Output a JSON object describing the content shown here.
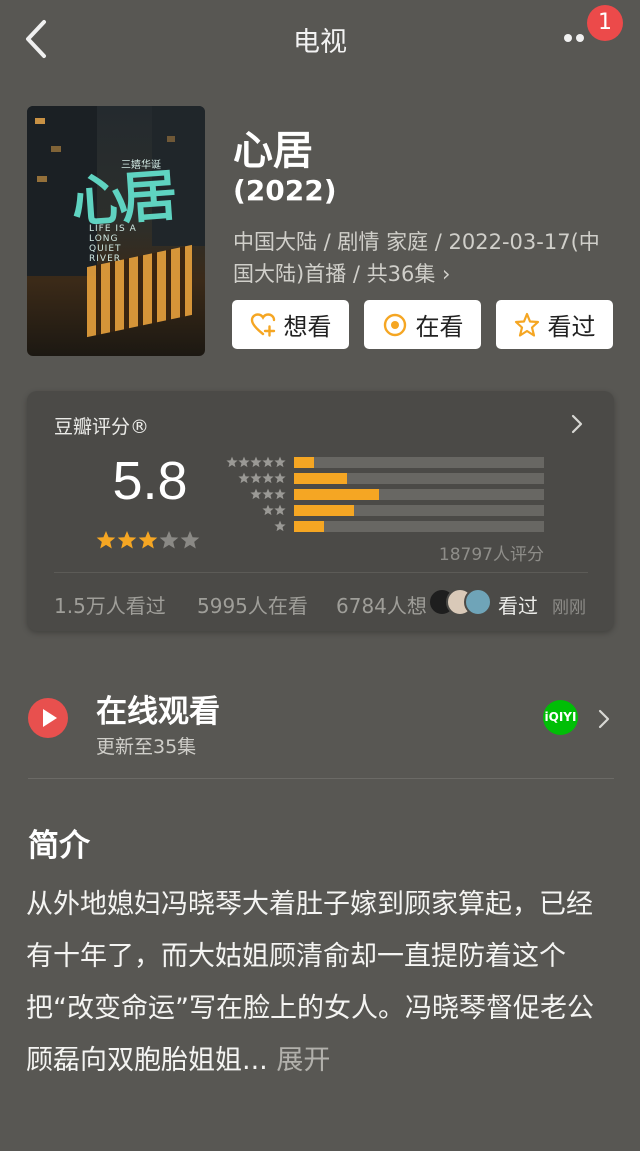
{
  "header": {
    "title": "电视",
    "notification_count": "1"
  },
  "poster": {
    "title_art": "心居",
    "subtitle_art": "LIFE IS A LONG QUIET RIVER",
    "small_art": "三嬉华诞"
  },
  "show": {
    "name": "心居",
    "year": "(2022)",
    "meta": "中国大陆 / 剧情 家庭 / 2022-03-17(中国大陆)首播 / 共36集 ›"
  },
  "actions": {
    "want": "想看",
    "watching": "在看",
    "watched": "看过"
  },
  "rating": {
    "label": "豆瓣评分®",
    "score": "5.8",
    "stars": 3,
    "count": "18797人评分",
    "distribution": [
      {
        "stars": 5,
        "fraction": 0.08
      },
      {
        "stars": 4,
        "fraction": 0.21
      },
      {
        "stars": 3,
        "fraction": 0.34
      },
      {
        "stars": 2,
        "fraction": 0.24
      },
      {
        "stars": 1,
        "fraction": 0.12
      }
    ],
    "stats": {
      "watched": "1.5万人看过",
      "watching": "5995人在看",
      "want": "6784人想",
      "friend_action": "看过",
      "time": "刚刚"
    }
  },
  "watch": {
    "title": "在线观看",
    "subtitle": "更新至35集",
    "platform_logo": "iQIYI"
  },
  "synopsis": {
    "title": "简介",
    "text": "从外地媳妇冯晓琴大着肚子嫁到顾家算起，已经有十年了，而大姑姐顾清俞却一直提防着这个把“改变命运”写在脸上的女人。冯晓琴督促老公顾磊向双胞胎姐姐...",
    "expand": " 展开"
  },
  "colors": {
    "background": "#585753",
    "card": "#4b4a47",
    "star": "#f5a623",
    "badge": "#ec4a4a",
    "play": "#e8504e",
    "iqiyi": "#00be06"
  }
}
